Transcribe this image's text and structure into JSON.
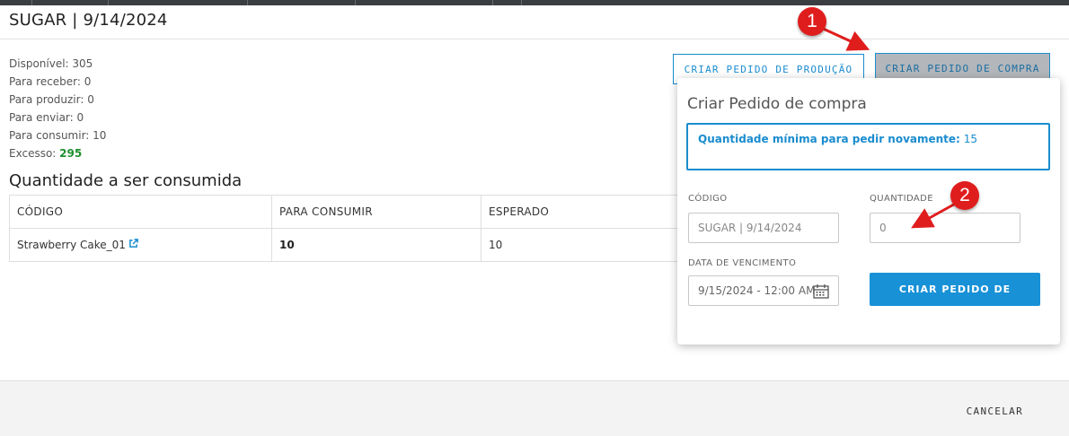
{
  "header": {
    "title": "SUGAR | 9/14/2024"
  },
  "stats": {
    "disponivel": "Disponível: 305",
    "receber": "Para receber: 0",
    "produzir": "Para produzir: 0",
    "enviar": "Para enviar: 0",
    "consumir": "Para consumir: 10",
    "excesso_label": "Excesso: ",
    "excesso_value": "295"
  },
  "section": {
    "title": "Quantidade a ser consumida"
  },
  "table": {
    "headers": [
      "CÓDIGO",
      "PARA CONSUMIR",
      "ESPERADO"
    ],
    "rows": [
      {
        "codigo": "Strawberry Cake_01",
        "consumir": "10",
        "esperado": "10"
      }
    ]
  },
  "toolbar": {
    "prod_label": "CRIAR PEDIDO DE PRODUÇÃO",
    "compra_label": "CRIAR PEDIDO DE COMPRA"
  },
  "popover": {
    "title": "Criar Pedido de compra",
    "info_label": "Quantidade mínima para pedir novamente:",
    "info_value": "15",
    "codigo_label": "CÓDIGO",
    "codigo_placeholder": "SUGAR | 9/14/2024",
    "quantidade_label": "QUANTIDADE",
    "quantidade_placeholder": "0",
    "vencimento_label": "DATA DE VENCIMENTO",
    "vencimento_value": "9/15/2024 - 12:00 AM",
    "submit_label": "CRIAR PEDIDO DE"
  },
  "footer": {
    "cancel_label": "CANCELAR"
  },
  "annotations": {
    "marker1": "1",
    "marker2": "2"
  },
  "colors": {
    "accent": "#1a8ccf",
    "primary_button": "#1891d7",
    "excess": "#1e8f2d",
    "marker": "#e01d1d"
  },
  "icons": {
    "external_link": "external-link-icon",
    "calendar": "calendar-icon"
  }
}
